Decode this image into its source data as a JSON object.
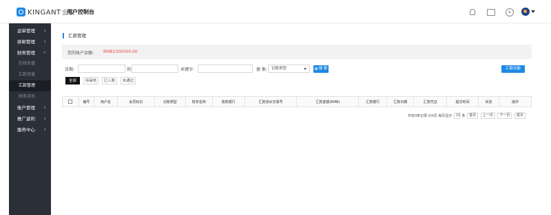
{
  "header": {
    "brand": "KINGANT",
    "brand_cn": "金蚁",
    "console_title": "用户控制台",
    "icons": [
      "bell-icon",
      "message-icon",
      "clock-icon",
      "avatar"
    ]
  },
  "sidebar": {
    "items": [
      {
        "label": "运单管理",
        "expanded": false
      },
      {
        "label": "拼邮管理",
        "expanded": false
      },
      {
        "label": "财务管理",
        "expanded": true,
        "children": [
          {
            "label": "在线充值",
            "active": false
          },
          {
            "label": "汇款充值",
            "active": false
          },
          {
            "label": "汇款管理",
            "active": true
          },
          {
            "label": "财务流水",
            "active": false
          }
        ]
      },
      {
        "label": "账户管理",
        "expanded": false
      },
      {
        "label": "推广返利",
        "expanded": false
      },
      {
        "label": "服务中心",
        "expanded": false
      }
    ]
  },
  "main": {
    "page_title": "汇款管理",
    "balance_label": "您的账户余额:",
    "balance_value": "RMB1000000.00",
    "filters": {
      "date_label": "日期:",
      "to_label": "到",
      "keyword_label": "关键字:",
      "search_label": "搜 索:",
      "record_type_value": "记账类型",
      "search_button": "搜 索",
      "remit_button": "汇款功能"
    },
    "tabs": [
      {
        "label": "全部",
        "active": true
      },
      {
        "label": "待审核",
        "active": false
      },
      {
        "label": "已入账",
        "active": false
      },
      {
        "label": "未通过",
        "active": false
      }
    ],
    "table": {
      "columns": [
        "编号",
        "用户名",
        "会员标识",
        "记账类型",
        "财务名称",
        "收款银行",
        "汇款流水交易号",
        "汇款金额(RMB)",
        "汇款银行",
        "汇款日期",
        "汇款凭证",
        "提交时间",
        "状态",
        "操作"
      ],
      "rows": []
    },
    "pagination": {
      "summary": "共有0条记录 0/0页 每页显示",
      "page_size": "10",
      "unit": "条",
      "first": "首页",
      "prev": "上一页",
      "next": "下一页",
      "last": "尾页"
    }
  },
  "colors": {
    "accent": "#1e88e5",
    "sidebar_bg": "#2a2f38",
    "balance_value": "#e84b4b"
  }
}
